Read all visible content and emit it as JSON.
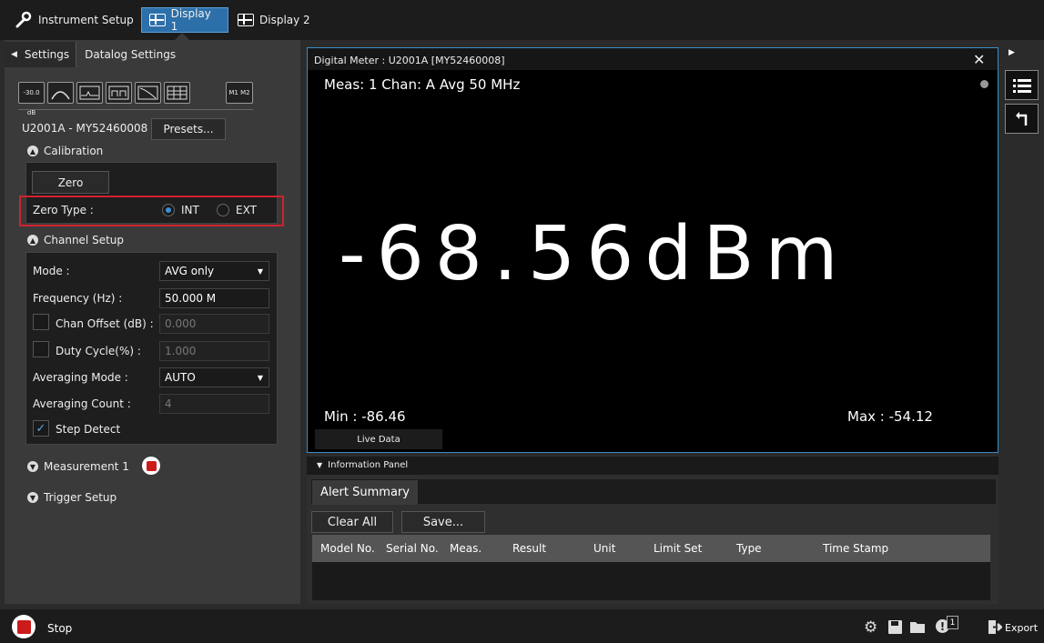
{
  "top_tabs": [
    {
      "label": "Instrument Setup"
    },
    {
      "label": "Display 1"
    },
    {
      "label": "Display 2"
    }
  ],
  "left_tabs": {
    "settings": "Settings",
    "datalog": "Datalog Settings"
  },
  "toolbar": {
    "range_icon_text": "-30.0 dB",
    "m1m2_text": "M1 M2"
  },
  "device": {
    "label": "U2001A - MY52460008",
    "presets": "Presets..."
  },
  "calibration": {
    "title": "Calibration",
    "zero_button": "Zero",
    "zero_type_label": "Zero Type :",
    "int_label": "INT",
    "ext_label": "EXT",
    "selected": "INT"
  },
  "channel": {
    "title": "Channel Setup",
    "mode_label": "Mode :",
    "mode_value": "AVG only",
    "freq_label": "Frequency (Hz) :",
    "freq_value": "50.000 M",
    "offset_label": "Chan Offset (dB) :",
    "offset_value": "0.000",
    "duty_label": "Duty Cycle(%) :",
    "duty_value": "1.000",
    "avgmode_label": "Averaging Mode :",
    "avgmode_value": "AUTO",
    "avgcount_label": "Averaging Count :",
    "avgcount_value": "4",
    "step_label": "Step Detect"
  },
  "measurement": {
    "title": "Measurement 1"
  },
  "trigger": {
    "title": "Trigger Setup"
  },
  "meter": {
    "title": "Digital Meter : U2001A [MY52460008]",
    "info": "Meas: 1 Chan: A  Avg  50 MHz",
    "reading": "-68.56dBm",
    "min": "Min : -86.46",
    "max": "Max  : -54.12",
    "live_tab": "Live Data"
  },
  "info_panel": {
    "title": "Information Panel",
    "tab": "Alert Summary",
    "clear": "Clear All",
    "save": "Save...",
    "columns": [
      "Model No.",
      "Serial No.",
      "Meas.",
      "Result",
      "Unit",
      "Limit Set",
      "Type",
      "Time Stamp"
    ]
  },
  "bottom": {
    "stop": "Stop",
    "export": "Export",
    "alert_count": "1"
  },
  "colors": {
    "accent": "#2d6fa8",
    "highlight_border": "#d0222e",
    "stop_red": "#cc1b1b"
  }
}
